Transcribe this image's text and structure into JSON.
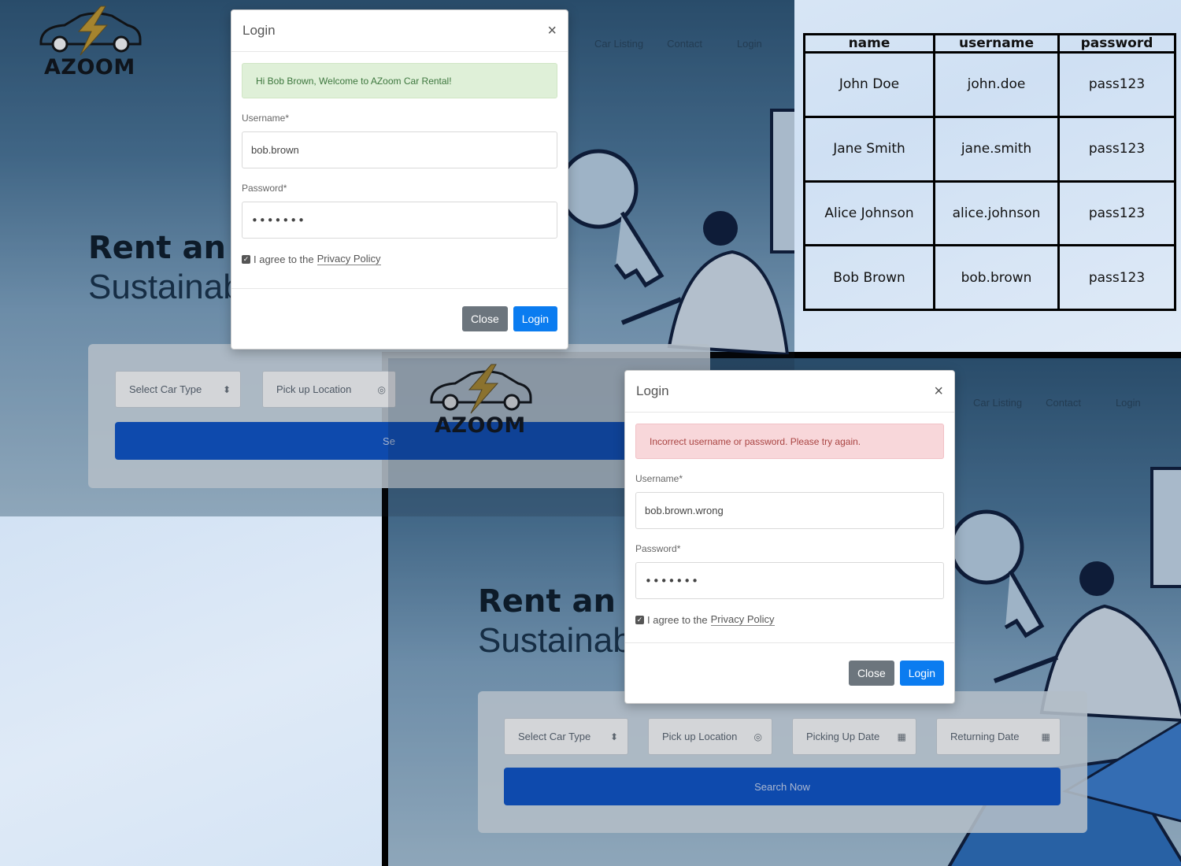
{
  "brand": {
    "name": "AZOOM"
  },
  "nav": {
    "car_listing": "Car Listing",
    "contact": "Contact",
    "login": "Login"
  },
  "hero": {
    "title": "Rent an I",
    "subtitle": "Sustainabl"
  },
  "search": {
    "car_type": "Select Car Type",
    "pickup_location": "Pick up Location",
    "pickup_date": "Picking Up Date",
    "return_date": "Returning Date",
    "button_label": "Search Now",
    "button_label_partial": "Se"
  },
  "modal_success": {
    "title": "Login",
    "close_glyph": "×",
    "alert": "Hi Bob Brown, Welcome to AZoom Car Rental!",
    "username_label": "Username*",
    "username_value": "bob.brown",
    "password_label": "Password*",
    "password_value": "•••••••",
    "agree_text": "I agree to the",
    "policy_link": "Privacy Policy",
    "close_button": "Close",
    "login_button": "Login"
  },
  "modal_error": {
    "title": "Login",
    "close_glyph": "×",
    "alert": "Incorrect username or password. Please try again.",
    "username_label": "Username*",
    "username_value": "bob.brown.wrong",
    "password_label": "Password*",
    "password_value": "•••••••",
    "agree_text": "I agree to the",
    "policy_link": "Privacy Policy",
    "close_button": "Close",
    "login_button": "Login"
  },
  "credentials_table": {
    "headers": [
      "name",
      "username",
      "password"
    ],
    "rows": [
      [
        "John Doe",
        "john.doe",
        "pass123"
      ],
      [
        "Jane Smith",
        "jane.smith",
        "pass123"
      ],
      [
        "Alice Johnson",
        "alice.johnson",
        "pass123"
      ],
      [
        "Bob Brown",
        "bob.brown",
        "pass123"
      ]
    ]
  },
  "colors": {
    "primary": "#0b7cf0",
    "search_button": "#0d54c9",
    "success_bg": "#dff0d8",
    "danger_bg": "#f8d7da"
  }
}
